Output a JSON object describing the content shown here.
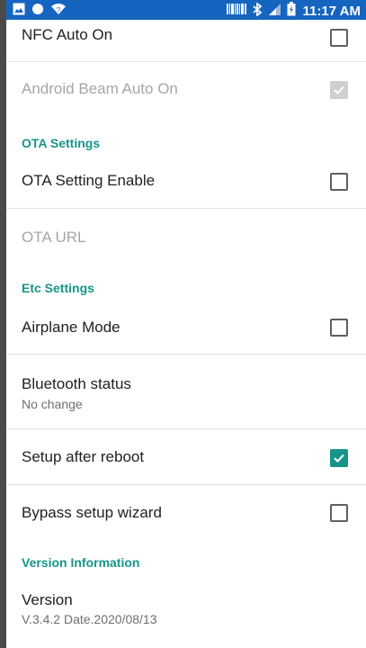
{
  "status_bar": {
    "time": "11:17 AM"
  },
  "nfc": {
    "auto_on_label": "NFC Auto On",
    "auto_on_checked": false,
    "beam_label": "Android Beam Auto On",
    "beam_checked": true
  },
  "ota": {
    "header": "OTA Settings",
    "enable_label": "OTA Setting Enable",
    "enable_checked": false,
    "url_label": "OTA URL"
  },
  "etc": {
    "header": "Etc Settings",
    "airplane_label": "Airplane Mode",
    "airplane_checked": false,
    "bluetooth_label": "Bluetooth status",
    "bluetooth_value": "No change",
    "reboot_label": "Setup after reboot",
    "reboot_checked": true,
    "bypass_label": "Bypass setup wizard",
    "bypass_checked": false
  },
  "version": {
    "header": "Version Information",
    "label": "Version",
    "value": "V.3.4.2 Date.2020/08/13"
  },
  "colors": {
    "accent": "#16948a",
    "status_bar": "#1565c0"
  }
}
